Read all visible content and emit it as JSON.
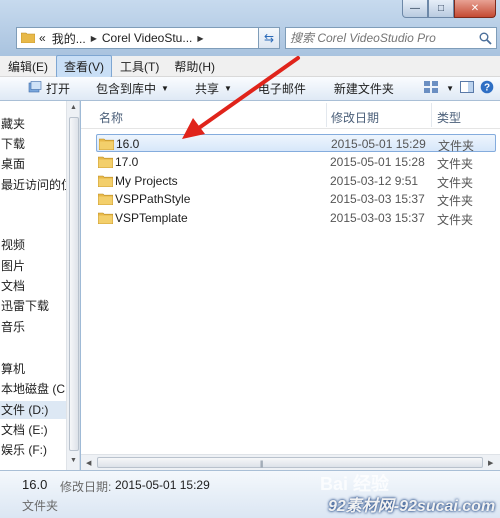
{
  "address_bar": {
    "crumbs": [
      "«",
      "我的...",
      "Corel VideoStu..."
    ]
  },
  "search": {
    "placeholder": "搜索 Corel VideoStudio Pro"
  },
  "menu": [
    {
      "label": "编辑(E)",
      "active": false
    },
    {
      "label": "查看(V)",
      "active": true
    },
    {
      "label": "工具(T)",
      "active": false
    },
    {
      "label": "帮助(H)",
      "active": false
    }
  ],
  "toolbar": {
    "open": "打开",
    "include_in_library": "包含到库中",
    "share": "共享",
    "email": "电子邮件",
    "new_folder": "新建文件夹"
  },
  "nav_items": [
    {
      "label": "藏夹",
      "selected": false
    },
    {
      "label": "下载",
      "selected": false
    },
    {
      "label": "桌面",
      "selected": false
    },
    {
      "label": "最近访问的位置",
      "selected": false
    },
    {
      "label": "视频",
      "selected": false
    },
    {
      "label": "图片",
      "selected": false
    },
    {
      "label": "文档",
      "selected": false
    },
    {
      "label": "迅雷下载",
      "selected": false
    },
    {
      "label": "音乐",
      "selected": false
    },
    {
      "label": "算机",
      "selected": false
    },
    {
      "label": "本地磁盘 (C:)",
      "selected": false
    },
    {
      "label": "文件 (D:)",
      "selected": true
    },
    {
      "label": "文档 (E:)",
      "selected": false
    },
    {
      "label": "娱乐 (F:)",
      "selected": false
    }
  ],
  "columns": {
    "name": "名称",
    "date": "修改日期",
    "type": "类型"
  },
  "files": [
    {
      "name": "16.0",
      "date": "2015-05-01 15:29",
      "type": "文件夹",
      "selected": true
    },
    {
      "name": "17.0",
      "date": "2015-05-01 15:28",
      "type": "文件夹",
      "selected": false
    },
    {
      "name": "My Projects",
      "date": "2015-03-12 9:51",
      "type": "文件夹",
      "selected": false
    },
    {
      "name": "VSPPathStyle",
      "date": "2015-03-03 15:37",
      "type": "文件夹",
      "selected": false
    },
    {
      "name": "VSPTemplate",
      "date": "2015-03-03 15:37",
      "type": "文件夹",
      "selected": false
    }
  ],
  "details": {
    "name": "16.0",
    "modified_label": "修改日期:",
    "modified_value": "2015-05-01 15:29",
    "type": "文件夹"
  },
  "watermarks": {
    "baidu": "Bai 经验",
    "site": "92素材网-92sucai.com"
  },
  "colors": {
    "accent": "#d7e7fa",
    "arrow": "#e0241b",
    "folder": "#e8b949"
  },
  "icons": {
    "folder": "folder-icon",
    "open": "open-icon",
    "search": "search-icon",
    "refresh": "refresh-icon"
  }
}
